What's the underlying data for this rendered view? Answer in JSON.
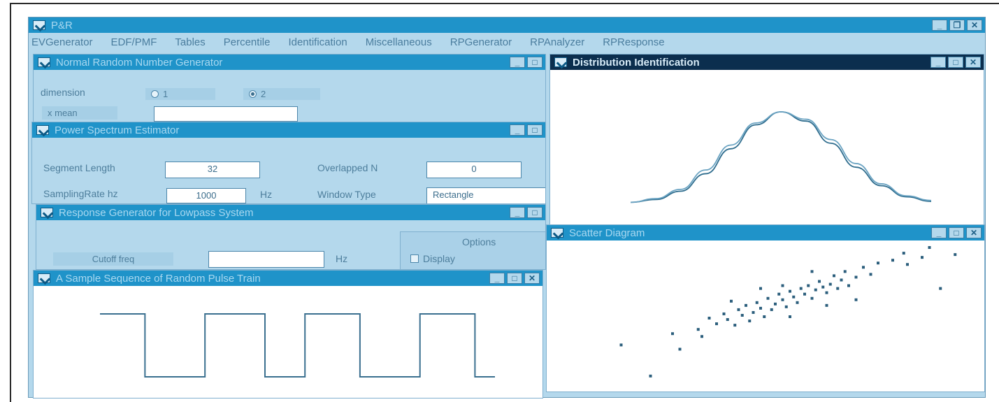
{
  "app": {
    "title": "P&R"
  },
  "menu": [
    "EVGenerator",
    "EDF/PMF",
    "Tables",
    "Percentile",
    "Identification",
    "Miscellaneous",
    "RPGenerator",
    "RPAnalyzer",
    "RPResponse"
  ],
  "normal_gen": {
    "title": "Normal Random Number Generator",
    "dimension_label": "dimension",
    "option1": "1",
    "option2": "2",
    "selected": "2",
    "xmean_label": "x mean",
    "xmean_value": ""
  },
  "power_spectrum": {
    "title": "Power Spectrum Estimator",
    "segment_length_label": "Segment Length",
    "segment_length_value": "32",
    "overlapped_label": "Overlapped N",
    "overlapped_value": "0",
    "sampling_rate_label": "SamplingRate hz",
    "sampling_rate_value": "1000",
    "hz_unit": "Hz",
    "window_type_label": "Window Type",
    "window_type_value": "Rectangle"
  },
  "response_gen": {
    "title": "Response Generator for Lowpass System",
    "cutoff_label": "Cutoff freq",
    "cutoff_value": "",
    "hz_unit": "Hz",
    "options_label": "Options",
    "display_label": "Display"
  },
  "pulse_train": {
    "title": "A Sample Sequence of Random Pulse Train",
    "levels": [
      1,
      0,
      1,
      0,
      1,
      0,
      1,
      0
    ],
    "durations": [
      45,
      60,
      60,
      40,
      55,
      60,
      55,
      20
    ]
  },
  "dist_id": {
    "title": "Distribution Identification",
    "chart_data": {
      "type": "line",
      "series": [
        {
          "values": [
            0.02,
            0.05,
            0.14,
            0.33,
            0.6,
            0.86,
            1.0,
            0.9,
            0.66,
            0.4,
            0.2,
            0.08,
            0.03
          ]
        },
        {
          "values": [
            0.02,
            0.06,
            0.16,
            0.37,
            0.64,
            0.88,
            1.0,
            0.92,
            0.7,
            0.44,
            0.22,
            0.09,
            0.04
          ]
        }
      ]
    }
  },
  "scatter": {
    "title": "Scatter Diagram",
    "chart_data": {
      "type": "scatter",
      "points": [
        [
          0.06,
          0.3
        ],
        [
          0.14,
          0.08
        ],
        [
          0.2,
          0.38
        ],
        [
          0.22,
          0.27
        ],
        [
          0.27,
          0.41
        ],
        [
          0.3,
          0.49
        ],
        [
          0.32,
          0.45
        ],
        [
          0.34,
          0.52
        ],
        [
          0.35,
          0.48
        ],
        [
          0.37,
          0.44
        ],
        [
          0.38,
          0.55
        ],
        [
          0.39,
          0.51
        ],
        [
          0.4,
          0.58
        ],
        [
          0.41,
          0.47
        ],
        [
          0.42,
          0.53
        ],
        [
          0.43,
          0.6
        ],
        [
          0.44,
          0.56
        ],
        [
          0.45,
          0.5
        ],
        [
          0.46,
          0.63
        ],
        [
          0.47,
          0.55
        ],
        [
          0.48,
          0.59
        ],
        [
          0.49,
          0.66
        ],
        [
          0.5,
          0.62
        ],
        [
          0.51,
          0.57
        ],
        [
          0.52,
          0.68
        ],
        [
          0.53,
          0.64
        ],
        [
          0.54,
          0.6
        ],
        [
          0.55,
          0.7
        ],
        [
          0.56,
          0.66
        ],
        [
          0.57,
          0.72
        ],
        [
          0.58,
          0.63
        ],
        [
          0.59,
          0.69
        ],
        [
          0.6,
          0.75
        ],
        [
          0.61,
          0.71
        ],
        [
          0.62,
          0.67
        ],
        [
          0.63,
          0.73
        ],
        [
          0.64,
          0.79
        ],
        [
          0.65,
          0.7
        ],
        [
          0.66,
          0.76
        ],
        [
          0.67,
          0.82
        ],
        [
          0.68,
          0.72
        ],
        [
          0.7,
          0.78
        ],
        [
          0.72,
          0.85
        ],
        [
          0.74,
          0.8
        ],
        [
          0.76,
          0.88
        ],
        [
          0.8,
          0.9
        ],
        [
          0.83,
          0.95
        ],
        [
          0.84,
          0.87
        ],
        [
          0.88,
          0.92
        ],
        [
          0.9,
          0.99
        ],
        [
          0.93,
          0.7
        ],
        [
          0.97,
          0.94
        ],
        [
          0.36,
          0.61
        ],
        [
          0.44,
          0.7
        ],
        [
          0.52,
          0.5
        ],
        [
          0.58,
          0.82
        ],
        [
          0.62,
          0.58
        ],
        [
          0.7,
          0.62
        ],
        [
          0.28,
          0.36
        ],
        [
          0.5,
          0.72
        ]
      ]
    }
  }
}
